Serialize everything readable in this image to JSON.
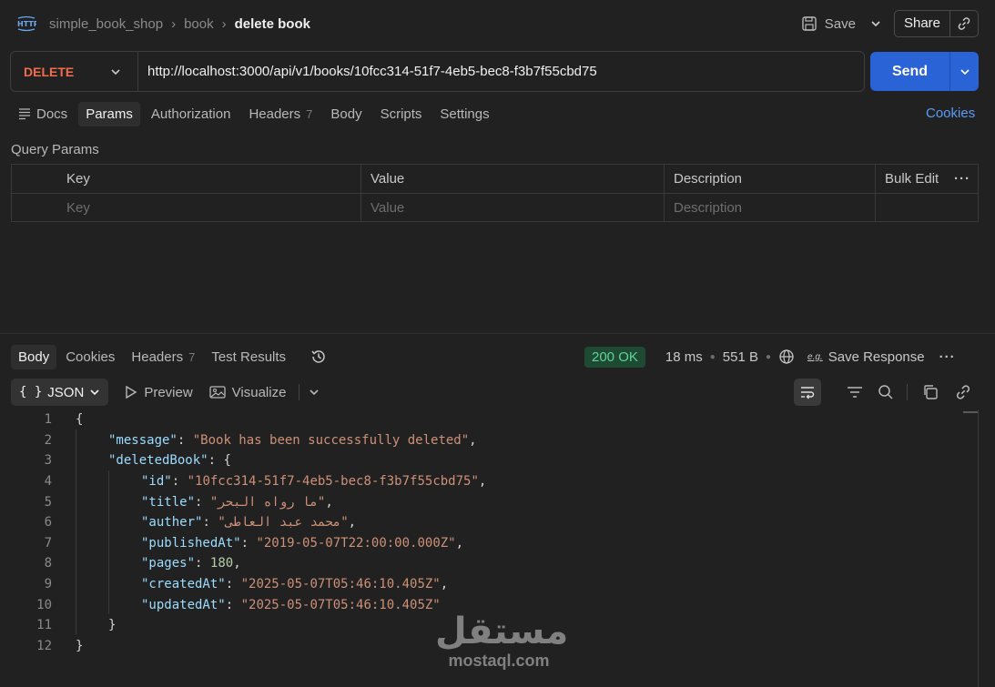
{
  "header": {
    "breadcrumb": [
      "simple_book_shop",
      "book"
    ],
    "current": "delete book",
    "save_label": "Save",
    "share_label": "Share"
  },
  "request": {
    "method": "DELETE",
    "url": "http://localhost:3000/api/v1/books/10fcc314-51f7-4eb5-bec8-f3b7f55cbd75",
    "send_label": "Send",
    "method_color": "#f26b4b"
  },
  "request_tabs": {
    "docs": "Docs",
    "params": "Params",
    "authorization": "Authorization",
    "headers": "Headers",
    "headers_count": "7",
    "body": "Body",
    "scripts": "Scripts",
    "settings": "Settings",
    "cookies": "Cookies"
  },
  "query_params": {
    "title": "Query Params",
    "columns": [
      "Key",
      "Value",
      "Description"
    ],
    "bulk_edit": "Bulk Edit",
    "placeholders": [
      "Key",
      "Value",
      "Description"
    ]
  },
  "response_tabs": {
    "body": "Body",
    "cookies": "Cookies",
    "headers": "Headers",
    "headers_count": "7",
    "test_results": "Test Results"
  },
  "response_meta": {
    "status": "200 OK",
    "time": "18 ms",
    "size": "551 B",
    "save_response": "Save Response"
  },
  "view": {
    "format": "JSON",
    "preview": "Preview",
    "visualize": "Visualize"
  },
  "code_lines": [
    "{",
    "\"message\": \"Book has been successfully deleted\",",
    "\"deletedBook\": {",
    "\"id\": \"10fcc314-51f7-4eb5-bec8-f3b7f55cbd75\",",
    "\"title\": \"ما رواه البحر\",",
    "\"auther\": \"محمد عبد العاطى\",",
    "\"publishedAt\": \"2019-05-07T22:00:00.000Z\",",
    "\"pages\": 180,",
    "\"createdAt\": \"2025-05-07T05:46:10.405Z\",",
    "\"updatedAt\": \"2025-05-07T05:46:10.405Z\"",
    "}",
    "}"
  ],
  "watermark": {
    "arabic": "مستقل",
    "latin": "mostaql.com"
  }
}
